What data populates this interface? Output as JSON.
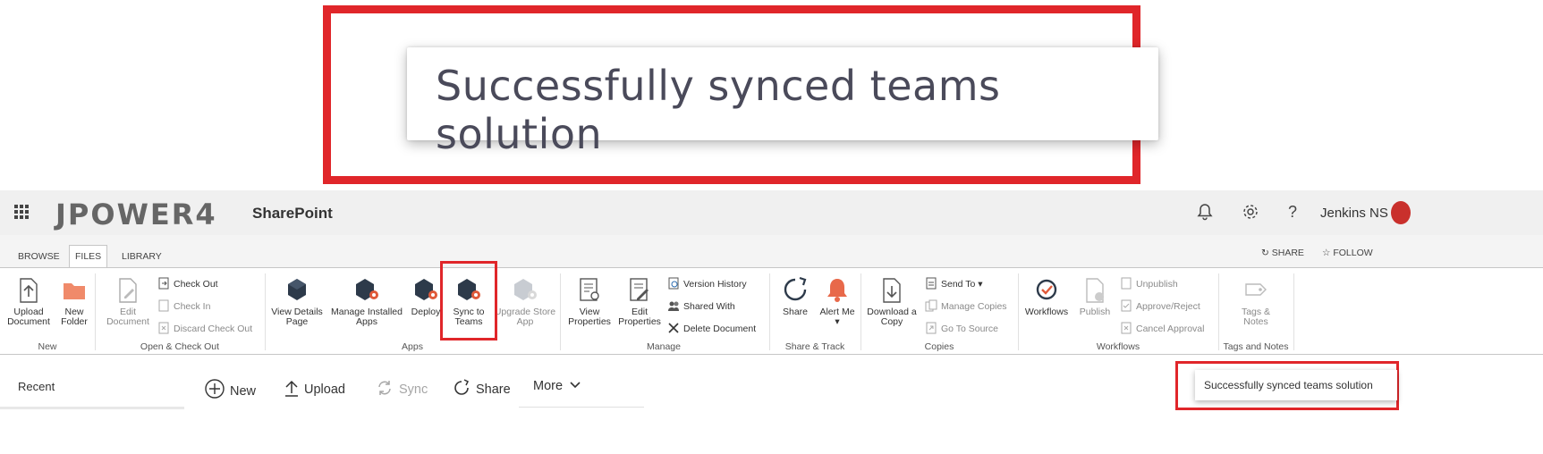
{
  "toast": {
    "message": "Successfully synced teams solution"
  },
  "suite_bar": {
    "brand": "JPOWER4",
    "app_name": "SharePoint",
    "user_name": "Jenkins NS",
    "help_glyph": "?"
  },
  "ribbon_tabs": {
    "browse": "BROWSE",
    "files": "FILES",
    "library": "LIBRARY",
    "share": "SHARE",
    "follow": "FOLLOW"
  },
  "ribbon": {
    "new": {
      "label": "New",
      "upload_document": "Upload Document",
      "new_folder": "New Folder"
    },
    "open_checkout": {
      "label": "Open & Check Out",
      "edit_document": "Edit Document",
      "check_out": "Check Out",
      "check_in": "Check In",
      "discard_check_out": "Discard Check Out"
    },
    "apps": {
      "label": "Apps",
      "view_details_page": "View Details Page",
      "manage_installed_apps": "Manage Installed Apps",
      "deploy": "Deploy",
      "sync_to_teams": "Sync to Teams",
      "upgrade_store_app": "Upgrade Store App"
    },
    "manage": {
      "label": "Manage",
      "view_properties": "View Properties",
      "edit_properties": "Edit Properties",
      "version_history": "Version History",
      "shared_with": "Shared With",
      "delete_document": "Delete Document"
    },
    "share_track": {
      "label": "Share & Track",
      "share": "Share",
      "alert_me": "Alert Me"
    },
    "copies": {
      "label": "Copies",
      "download_a_copy": "Download a Copy",
      "send_to": "Send To",
      "manage_copies": "Manage Copies",
      "go_to_source": "Go To Source"
    },
    "workflows": {
      "label": "Workflows",
      "workflows": "Workflows",
      "publish": "Publish",
      "unpublish": "Unpublish",
      "approve_reject": "Approve/Reject",
      "cancel_approval": "Cancel Approval"
    },
    "tags_notes": {
      "label": "Tags and Notes",
      "tags_notes": "Tags & Notes"
    }
  },
  "command_bar": {
    "recent": "Recent",
    "new": "New",
    "upload": "Upload",
    "sync": "Sync",
    "share": "Share",
    "more": "More"
  },
  "colors": {
    "highlight": "#e0262a",
    "suite_bg": "#f0f0f0",
    "alert_icon": "#e8694a",
    "folder": "#f08a6a"
  }
}
